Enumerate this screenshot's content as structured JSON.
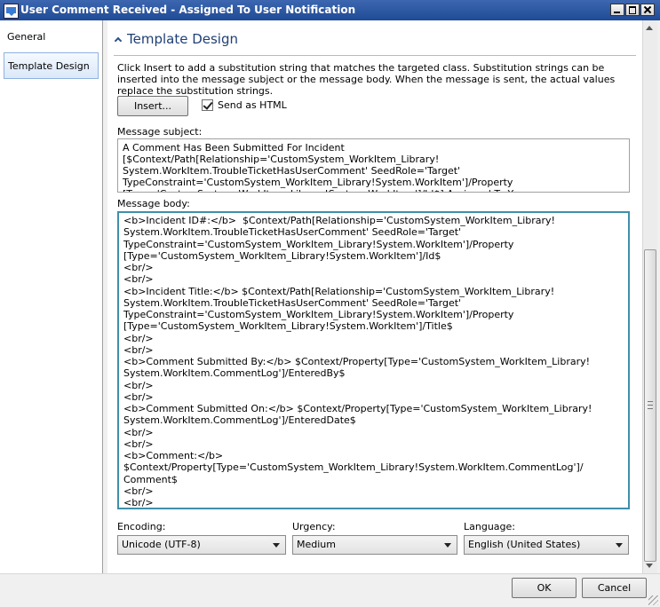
{
  "window": {
    "title": "User Comment Received - Assigned To User Notification"
  },
  "nav": {
    "items": [
      {
        "label": "General"
      },
      {
        "label": "Template Design"
      }
    ]
  },
  "section": {
    "title": "Template Design"
  },
  "description": "Click Insert to add a substitution string that matches the targeted class. Substitution strings can be inserted into the message subject or the message body. When the message is sent, the actual values replace the substitution strings.",
  "toolbar": {
    "insert_label": "Insert...",
    "send_html_label": "Send as HTML",
    "send_html_checked": true
  },
  "subject": {
    "label": "Message subject:",
    "value": "A Comment Has Been Submitted For Incident [$Context/Path[Relationship='CustomSystem_WorkItem_Library!\nSystem.WorkItem.TroubleTicketHasUserComment' SeedRole='Target'\nTypeConstraint='CustomSystem_WorkItem_Library!System.WorkItem']/Property\n[Type='CustomSystem_WorkItem_Library!System.WorkItem']/Id$] Assigned To You"
  },
  "body": {
    "label": "Message body:",
    "value": "<b>Incident ID#:</b>  $Context/Path[Relationship='CustomSystem_WorkItem_Library!\nSystem.WorkItem.TroubleTicketHasUserComment' SeedRole='Target'\nTypeConstraint='CustomSystem_WorkItem_Library!System.WorkItem']/Property\n[Type='CustomSystem_WorkItem_Library!System.WorkItem']/Id$\n<br/>\n<br/>\n<b>Incident Title:</b> $Context/Path[Relationship='CustomSystem_WorkItem_Library!\nSystem.WorkItem.TroubleTicketHasUserComment' SeedRole='Target'\nTypeConstraint='CustomSystem_WorkItem_Library!System.WorkItem']/Property\n[Type='CustomSystem_WorkItem_Library!System.WorkItem']/Title$\n<br/>\n<br/>\n<b>Comment Submitted By:</b> $Context/Property[Type='CustomSystem_WorkItem_Library!\nSystem.WorkItem.CommentLog']/EnteredBy$\n<br/>\n<br/>\n<b>Comment Submitted On:</b> $Context/Property[Type='CustomSystem_WorkItem_Library!\nSystem.WorkItem.CommentLog']/EnteredDate$\n<br/>\n<br/>\n<b>Comment:</b> $Context/Property[Type='CustomSystem_WorkItem_Library!System.WorkItem.CommentLog']/\nComment$\n<br/>\n<br/>"
  },
  "encoding": {
    "label": "Encoding:",
    "value": "Unicode (UTF-8)"
  },
  "urgency": {
    "label": "Urgency:",
    "value": "Medium"
  },
  "language": {
    "label": "Language:",
    "value": "English (United States)"
  },
  "footer": {
    "ok_label": "OK",
    "cancel_label": "Cancel"
  }
}
